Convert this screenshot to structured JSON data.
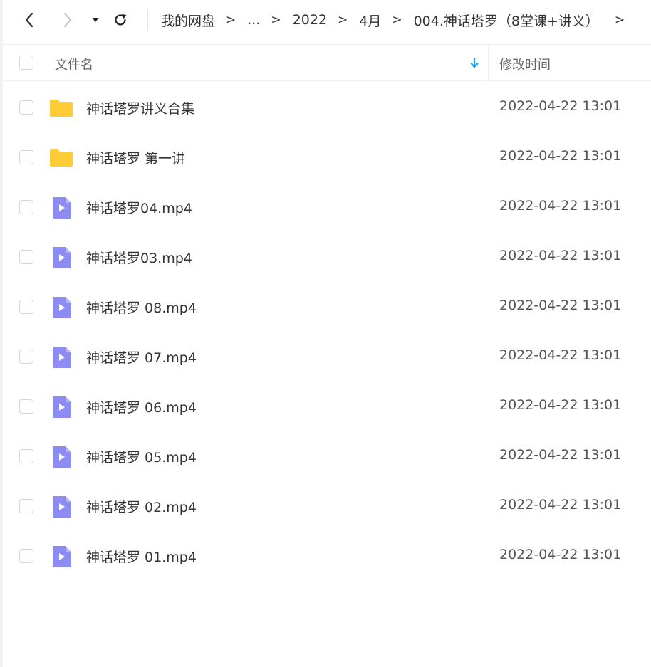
{
  "toolbar": {
    "back_icon": "chevron-left-icon",
    "forward_icon": "chevron-right-icon",
    "history_icon": "caret-down-icon",
    "refresh_icon": "refresh-icon"
  },
  "breadcrumb": {
    "items": [
      {
        "label": "我的网盘"
      },
      {
        "label": "..."
      },
      {
        "label": "2022"
      },
      {
        "label": "4月"
      },
      {
        "label": "004.神话塔罗（8堂课+讲义）"
      }
    ],
    "separator": ">"
  },
  "list": {
    "header": {
      "name_label": "文件名",
      "time_label": "修改时间",
      "sort_icon": "sort-down-arrow-icon"
    },
    "rows": [
      {
        "type": "folder",
        "name": "神话塔罗讲义合集",
        "modified": "2022-04-22 13:01"
      },
      {
        "type": "folder",
        "name": "神话塔罗 第一讲",
        "modified": "2022-04-22 13:01"
      },
      {
        "type": "video",
        "name": "神话塔罗04.mp4",
        "modified": "2022-04-22 13:01"
      },
      {
        "type": "video",
        "name": "神话塔罗03.mp4",
        "modified": "2022-04-22 13:01"
      },
      {
        "type": "video",
        "name": "神话塔罗 08.mp4",
        "modified": "2022-04-22 13:01"
      },
      {
        "type": "video",
        "name": "神话塔罗 07.mp4",
        "modified": "2022-04-22 13:01"
      },
      {
        "type": "video",
        "name": "神话塔罗 06.mp4",
        "modified": "2022-04-22 13:01"
      },
      {
        "type": "video",
        "name": "神话塔罗 05.mp4",
        "modified": "2022-04-22 13:01"
      },
      {
        "type": "video",
        "name": "神话塔罗 02.mp4",
        "modified": "2022-04-22 13:01"
      },
      {
        "type": "video",
        "name": "神话塔罗 01.mp4",
        "modified": "2022-04-22 13:01"
      }
    ]
  },
  "colors": {
    "folder": "#ffcb37",
    "video": "#8c8cf2",
    "sort_accent": "#1a9bff"
  }
}
